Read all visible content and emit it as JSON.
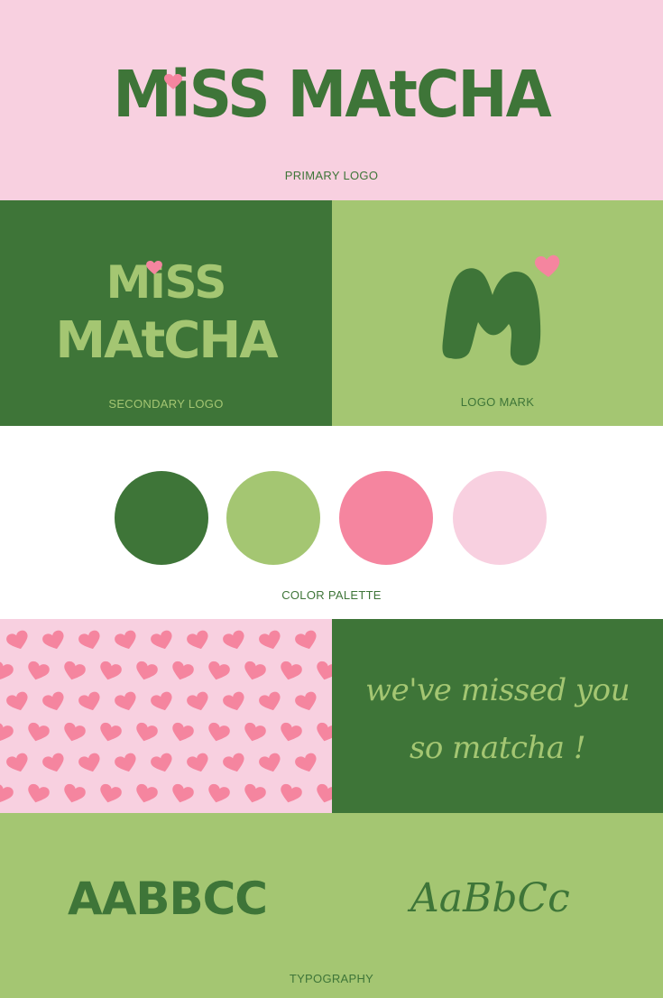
{
  "colors": {
    "dark_green": "#3e7538",
    "light_green": "#a4c672",
    "pink": "#f5859f",
    "light_pink": "#f8d0e0",
    "white": "#ffffff"
  },
  "primary": {
    "logo_text": "MiSS MAtCHA",
    "caption": "PRIMARY LOGO"
  },
  "secondary": {
    "logo_line1": "MiSS",
    "logo_line2": "MAtCHA",
    "caption": "SECONDARY LOGO"
  },
  "mark": {
    "letter": "M",
    "caption": "LOGO MARK"
  },
  "palette": {
    "swatches": [
      "#3e7538",
      "#a4c672",
      "#f5859f",
      "#f8d0e0"
    ],
    "caption": "COLOR PALETTE"
  },
  "pattern": {
    "icon": "heart-icon"
  },
  "quote": {
    "line1": "we've missed you",
    "line2": "so matcha !"
  },
  "typography": {
    "display_sample": "AABBCC",
    "script_sample": "AaBbCc",
    "caption": "TYPOGRAPHY"
  }
}
